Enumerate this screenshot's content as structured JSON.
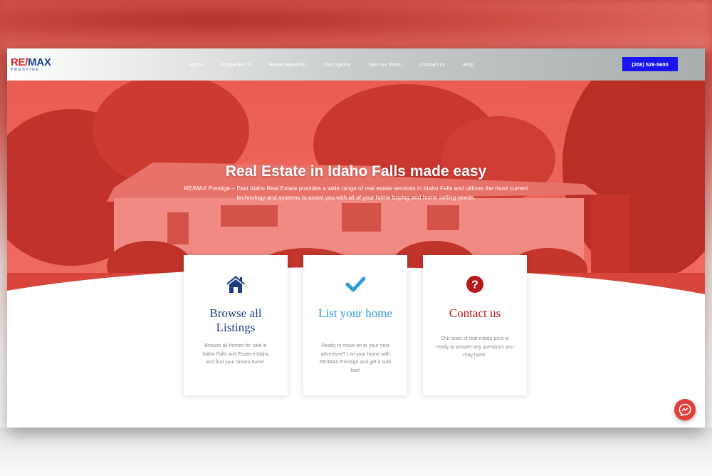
{
  "brand": {
    "logo_main_re": "RE",
    "logo_main_slash": "/",
    "logo_main_max": "MAX",
    "logo_sub": "PRESTIGE"
  },
  "nav": {
    "items": [
      {
        "label": "Home"
      },
      {
        "label": "Properties",
        "has_dropdown": true
      },
      {
        "label": "Home Valuation"
      },
      {
        "label": "Our Agents"
      },
      {
        "label": "Join our Team"
      },
      {
        "label": "Contact us"
      },
      {
        "label": "Blog"
      }
    ],
    "dropdown_caret": "▾",
    "phone": "(208) 529-5600"
  },
  "hero": {
    "title": "Real Estate in Idaho Falls made easy",
    "description": "RE/MAX Prestige – East Idaho Real Estate provides a wide range of real estate services in Idaho Falls and utilizes the most current technology and systems to assist you with all of your home buying and home selling needs."
  },
  "cards": [
    {
      "icon": "home-icon",
      "title": "Browse all Listings",
      "text": "Browse all homes for sale in Idaho Falls and Eastern Idaho and find your dream home.",
      "color": "#1d3e7e"
    },
    {
      "icon": "checkmark-icon",
      "title": "List your home",
      "text": "Ready to move on to your next adventure? List your home with RE/MAX Prestige and get it sold fast!",
      "color": "#2e9ad9"
    },
    {
      "icon": "question-icon",
      "title": "Contact us",
      "text": "Our team of real estate pros is ready to answer any questions you may have.",
      "color": "#b51a1a"
    }
  ],
  "colors": {
    "brand_red": "#d3282d",
    "brand_blue": "#1b3f8c",
    "phone_button": "#1a14f2",
    "hero_overlay": "#f04438",
    "messenger": "#e33f3a"
  },
  "widgets": {
    "messenger_icon": "messenger-icon"
  }
}
